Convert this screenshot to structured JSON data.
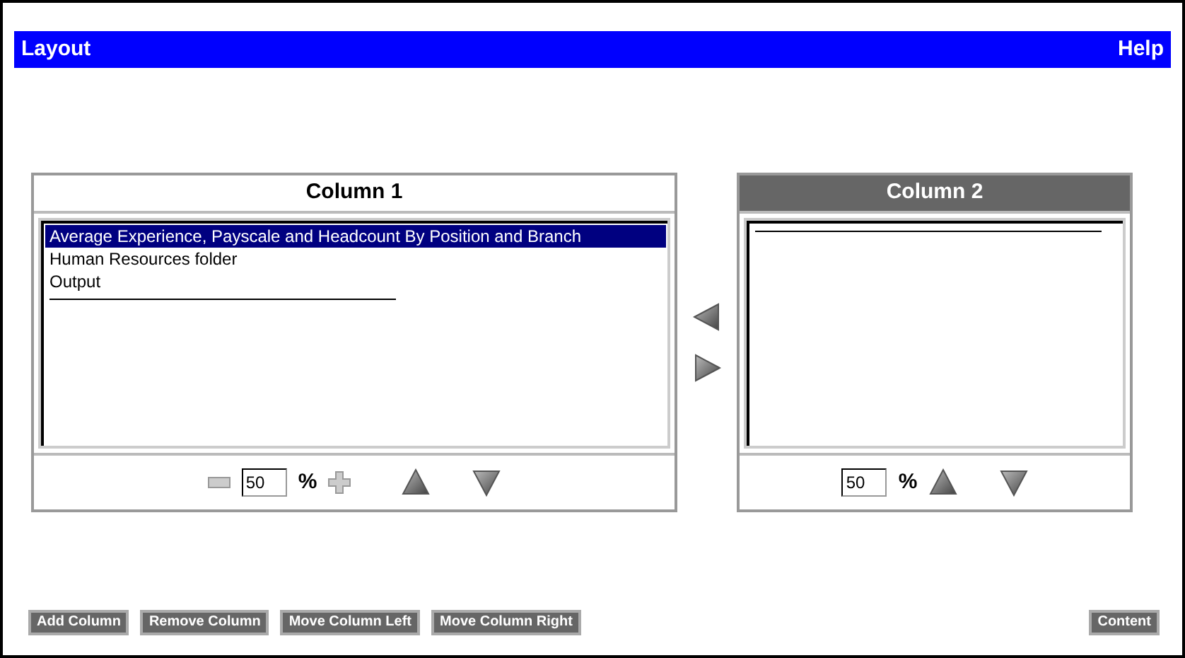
{
  "title_bar": {
    "title": "Layout",
    "help": "Help"
  },
  "columns": [
    {
      "title": "Column 1",
      "selected": false,
      "width_buttons": true,
      "width_value": "50",
      "percent": "%",
      "items": [
        {
          "label": "Average Experience, Payscale and Headcount By Position and Branch",
          "selected": true
        },
        {
          "label": "Human Resources folder",
          "selected": false
        },
        {
          "label": "Output",
          "selected": false
        }
      ]
    },
    {
      "title": "Column 2",
      "selected": true,
      "width_buttons": false,
      "width_value": "50",
      "percent": "%"
    }
  ],
  "buttons": [
    "Add Column",
    "Remove Column",
    "Move Column Left",
    "Move Column Right"
  ],
  "right_button": "Content"
}
